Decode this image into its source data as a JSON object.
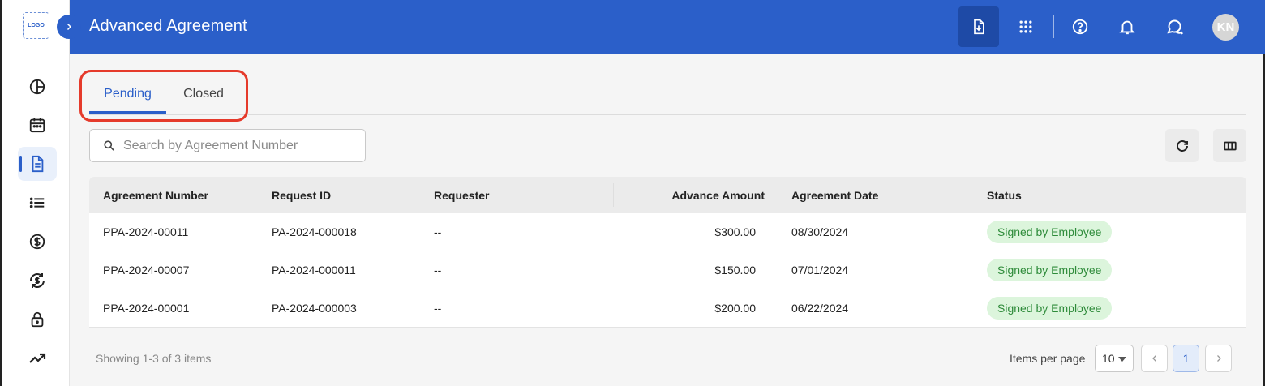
{
  "sidebar": {
    "logo_text": "LOGO",
    "items": [
      {
        "icon": "pie-chart-icon"
      },
      {
        "icon": "calendar-icon"
      },
      {
        "icon": "document-icon",
        "active": true
      },
      {
        "icon": "list-icon"
      },
      {
        "icon": "dollar-icon"
      },
      {
        "icon": "currency-exchange-icon"
      },
      {
        "icon": "lock-icon"
      },
      {
        "icon": "trending-up-icon"
      }
    ]
  },
  "header": {
    "title": "Advanced Agreement",
    "avatar_initials": "KN",
    "icons": [
      "download-document-icon",
      "apps-grid-icon",
      "help-icon",
      "bell-icon",
      "chat-icon"
    ]
  },
  "tabs": [
    {
      "label": "Pending",
      "active": true
    },
    {
      "label": "Closed",
      "active": false
    }
  ],
  "search": {
    "placeholder": "Search by Agreement Number",
    "value": ""
  },
  "table": {
    "columns": [
      "Agreement Number",
      "Request ID",
      "Requester",
      "Advance Amount",
      "Agreement Date",
      "Status"
    ],
    "rows": [
      {
        "agreement_number": "PPA-2024-00011",
        "request_id": "PA-2024-000018",
        "requester": "--",
        "advance_amount": "$300.00",
        "agreement_date": "08/30/2024",
        "status": "Signed by Employee"
      },
      {
        "agreement_number": "PPA-2024-00007",
        "request_id": "PA-2024-000011",
        "requester": "--",
        "advance_amount": "$150.00",
        "agreement_date": "07/01/2024",
        "status": "Signed by Employee"
      },
      {
        "agreement_number": "PPA-2024-00001",
        "request_id": "PA-2024-000003",
        "requester": "--",
        "advance_amount": "$200.00",
        "agreement_date": "06/22/2024",
        "status": "Signed by Employee"
      }
    ]
  },
  "footer": {
    "showing": "Showing 1-3 of 3 items",
    "items_per_page_label": "Items per page",
    "items_per_page_value": "10",
    "current_page": "1"
  },
  "colors": {
    "primary": "#2b5fc9",
    "header_bg": "#2b5fc9",
    "badge_bg": "#dcf5dc",
    "badge_text": "#2e8b3a",
    "highlight_ring": "#e53a2b"
  }
}
